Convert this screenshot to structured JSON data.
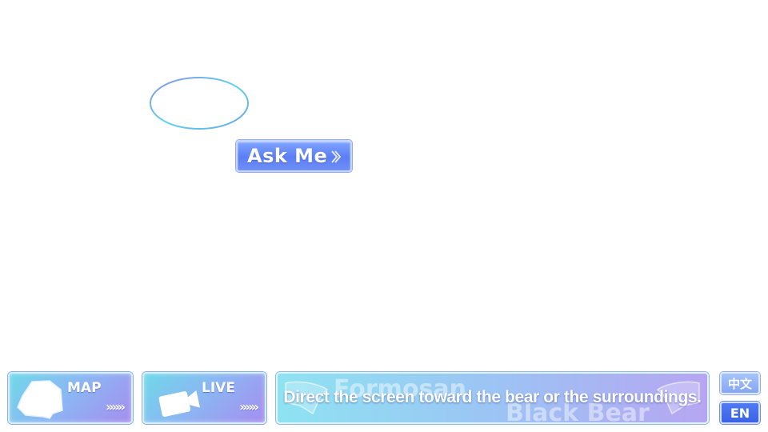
{
  "ask_button": {
    "label": "Ask Me",
    "icon": "chevron-right-double-icon"
  },
  "nav": {
    "map": {
      "label": "MAP",
      "arrows": "»»»",
      "icon": "map-icon"
    },
    "live": {
      "label": "LIVE",
      "arrows": "»»»",
      "icon": "video-camera-icon"
    }
  },
  "caption": {
    "text": "Direct the screen toward the bear or the surroundings.",
    "watermark_1": "Formosan",
    "watermark_2": "Black Bear"
  },
  "language": {
    "chinese": "中文",
    "english": "EN",
    "active": "EN"
  },
  "colors": {
    "accent_blue": "#5b7ef5",
    "panel_cyan": "#8ee3f2",
    "panel_violet": "#b6a6f2"
  }
}
